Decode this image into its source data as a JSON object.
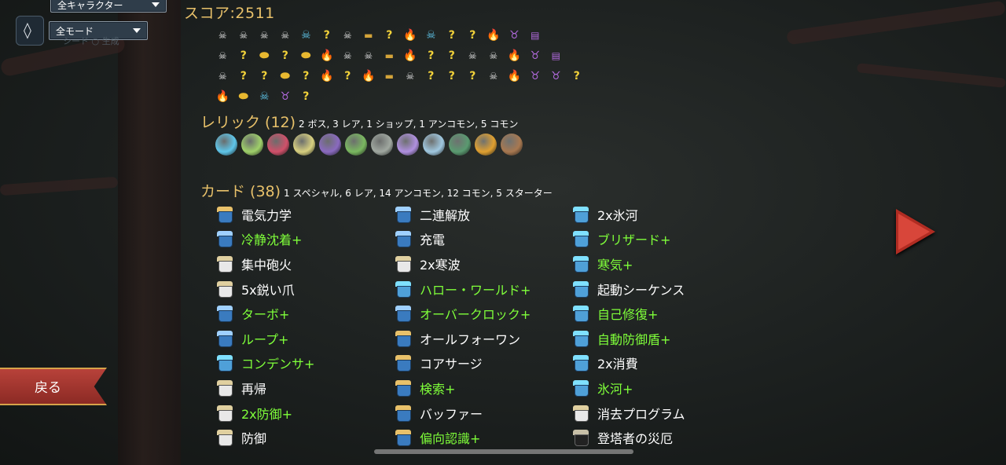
{
  "filters": {
    "character": "全キャラクター",
    "mode": "全モード",
    "seed_icon": "diamond-icon",
    "ghost_caption": "シード ○ 生成"
  },
  "score": "スコア:2511",
  "path": {
    "rows": [
      [
        "monster",
        "monster",
        "monster",
        "monster",
        "monster-blue",
        "unknown",
        "monster",
        "chest",
        "unknown",
        "rest",
        "monster-blue",
        "unknown-monster",
        "unknown",
        "rest",
        "elite",
        "shop"
      ],
      [
        "monster",
        "unknown",
        "gold",
        "unknown",
        "gold",
        "rest",
        "monster",
        "monster",
        "chest",
        "rest",
        "unknown-monster",
        "unknown",
        "monster",
        "monster",
        "rest",
        "elite",
        "shop"
      ],
      [
        "monster",
        "unknown-monster",
        "unknown",
        "gold",
        "unknown",
        "rest",
        "unknown-monster",
        "rest",
        "chest",
        "monster",
        "unknown",
        "unknown-monster",
        "unknown",
        "monster",
        "rest",
        "elite",
        "elite",
        "unknown"
      ],
      [
        "rest",
        "gold",
        "monster-blue",
        "elite",
        "unknown"
      ]
    ],
    "glyphs": {
      "monster": "☠",
      "monster-blue": "☠",
      "unknown": "?",
      "unknown-monster": "?",
      "gold": "⬬",
      "rest": "🔥",
      "chest": "▬",
      "elite": "♉",
      "shop": "▤"
    }
  },
  "relics": {
    "title": "レリック (12)",
    "summary": "2 ボス, 3 レア, 1 ショップ, 1 アンコモン, 5 コモン",
    "items": [
      {
        "name": "relic-1",
        "color": "#5fc6ea"
      },
      {
        "name": "relic-2",
        "color": "#9fd06a"
      },
      {
        "name": "relic-3",
        "color": "#d0506a"
      },
      {
        "name": "relic-4",
        "color": "#d8d080"
      },
      {
        "name": "relic-5",
        "color": "#8a6ac0"
      },
      {
        "name": "relic-6",
        "color": "#7ab860"
      },
      {
        "name": "relic-7",
        "color": "#a0a8a0"
      },
      {
        "name": "relic-8",
        "color": "#b090e0"
      },
      {
        "name": "relic-9",
        "color": "#a0c8e0"
      },
      {
        "name": "relic-10",
        "color": "#5a9a70"
      },
      {
        "name": "relic-11",
        "color": "#e0a030"
      },
      {
        "name": "relic-12",
        "color": "#a87850"
      }
    ]
  },
  "cards": {
    "title": "カード (38)",
    "summary": "1 スペシャル, 6 レア, 14 アンコモン, 12 コモン, 5 スターター",
    "columns": [
      [
        {
          "name": "電気力学",
          "up": false,
          "type": "gold"
        },
        {
          "name": "冷静沈着+",
          "up": true,
          "type": "blue"
        },
        {
          "name": "集中砲火",
          "up": false,
          "type": "white"
        },
        {
          "name": "5x鋭い爪",
          "up": false,
          "type": "white"
        },
        {
          "name": "ターボ+",
          "up": true,
          "type": "blue"
        },
        {
          "name": "ループ+",
          "up": true,
          "type": "blue"
        },
        {
          "name": "コンデンサ+",
          "up": true,
          "type": "cyan"
        },
        {
          "name": "再帰",
          "up": false,
          "type": "white"
        },
        {
          "name": "2x防御+",
          "up": true,
          "type": "white"
        },
        {
          "name": "防御",
          "up": false,
          "type": "white"
        }
      ],
      [
        {
          "name": "二連解放",
          "up": false,
          "type": "blue"
        },
        {
          "name": "充電",
          "up": false,
          "type": "blue"
        },
        {
          "name": "2x寒波",
          "up": false,
          "type": "white"
        },
        {
          "name": "ハロー・ワールド+",
          "up": true,
          "type": "cyan"
        },
        {
          "name": "オーバークロック+",
          "up": true,
          "type": "blue"
        },
        {
          "name": "オールフォーワン",
          "up": false,
          "type": "gold"
        },
        {
          "name": "コアサージ",
          "up": false,
          "type": "gold"
        },
        {
          "name": "検索+",
          "up": true,
          "type": "gold"
        },
        {
          "name": "バッファー",
          "up": false,
          "type": "gold"
        },
        {
          "name": "偏向認識+",
          "up": true,
          "type": "gold"
        }
      ],
      [
        {
          "name": "2x氷河",
          "up": false,
          "type": "cyan"
        },
        {
          "name": "ブリザード+",
          "up": true,
          "type": "cyan"
        },
        {
          "name": "寒気+",
          "up": true,
          "type": "cyan"
        },
        {
          "name": "起動シーケンス",
          "up": false,
          "type": "cyan"
        },
        {
          "name": "自己修復+",
          "up": true,
          "type": "cyan"
        },
        {
          "name": "自動防御盾+",
          "up": true,
          "type": "cyan"
        },
        {
          "name": "2x消費",
          "up": false,
          "type": "cyan"
        },
        {
          "name": "氷河+",
          "up": true,
          "type": "cyan"
        },
        {
          "name": "消去プログラム",
          "up": false,
          "type": "white"
        },
        {
          "name": "登塔者の災厄",
          "up": false,
          "type": "curse"
        }
      ]
    ]
  },
  "back_button": "戻る",
  "next_icon": "arrow-right-icon"
}
